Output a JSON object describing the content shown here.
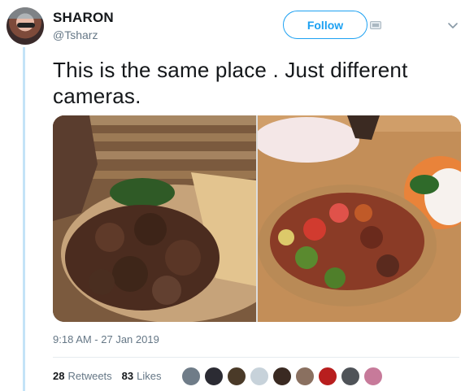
{
  "user": {
    "display_name": "SHARON",
    "handle": "@Tsharz"
  },
  "follow": {
    "label": "Follow"
  },
  "tweet": {
    "text": "This is the same place . Just different cameras.",
    "timestamp": "9:18 AM - 27 Jan 2019"
  },
  "stats": {
    "retweets_count": "28",
    "retweets_label": "Retweets",
    "likes_count": "83",
    "likes_label": "Likes"
  },
  "likers": [
    {
      "color": "#6f7c88"
    },
    {
      "color": "#2b2b33"
    },
    {
      "color": "#4a3a28"
    },
    {
      "color": "#c7d2da"
    },
    {
      "color": "#3a2a22"
    },
    {
      "color": "#8a7060"
    },
    {
      "color": "#b81e1e"
    },
    {
      "color": "#4f5358"
    },
    {
      "color": "#c77a9a"
    }
  ],
  "colors": {
    "accent": "#1da1f2",
    "muted": "#657786",
    "thread_line": "#c4e3f7"
  },
  "icons": {
    "caret": "chevron-down-icon",
    "follow_badge": "card-icon"
  }
}
